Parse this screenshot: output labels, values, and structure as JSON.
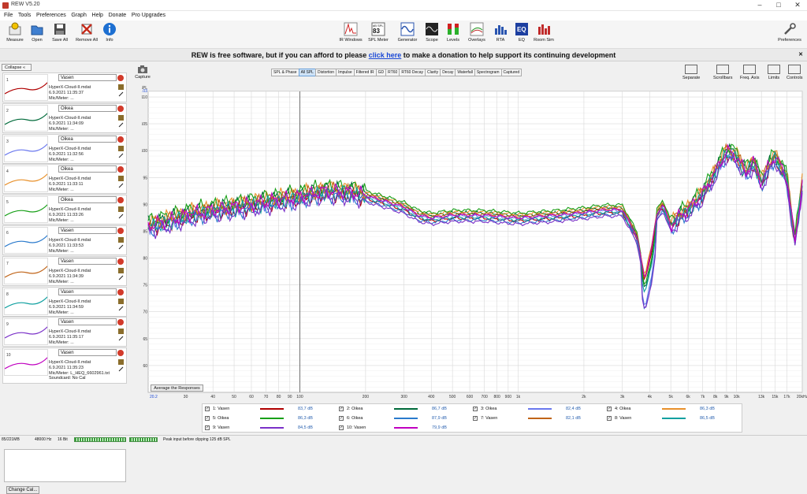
{
  "window": {
    "title": "REW V5.20",
    "minimize": "–",
    "maximize": "□",
    "close": "✕"
  },
  "menu": [
    "File",
    "Tools",
    "Preferences",
    "Graph",
    "Help",
    "Donate",
    "Pro Upgrades"
  ],
  "toolbar_left": [
    {
      "label": "Measure",
      "icon": "microphone-icon"
    },
    {
      "label": "Open",
      "icon": "folder-icon"
    },
    {
      "label": "Save All",
      "icon": "save-icon"
    },
    {
      "label": "Remove All",
      "icon": "remove-all-icon"
    },
    {
      "label": "Info",
      "icon": "info-icon"
    }
  ],
  "toolbar_center": [
    {
      "label": "IR Windows",
      "icon": "ir-windows-icon"
    },
    {
      "label": "SPL Meter",
      "icon": "spl-meter-icon",
      "top": "dB SPL",
      "value": "83"
    },
    {
      "label": "Generator",
      "icon": "generator-icon"
    },
    {
      "label": "Scope",
      "icon": "scope-icon"
    },
    {
      "label": "Levels",
      "icon": "levels-icon"
    },
    {
      "label": "Overlays",
      "icon": "overlays-icon"
    },
    {
      "label": "RTA",
      "icon": "rta-icon"
    },
    {
      "label": "EQ",
      "icon": "eq-icon"
    },
    {
      "label": "Room Sim",
      "icon": "room-sim-icon"
    }
  ],
  "toolbar_right": {
    "label": "Preferences",
    "icon": "wrench-icon"
  },
  "banner": {
    "pre": "REW is free software, but if you can afford to please ",
    "link": "click here",
    "post": " to make a donation to help support its continuing development"
  },
  "left_panel": {
    "collapse_label": "Collapse",
    "items": [
      {
        "num": "1",
        "name": "Vasen",
        "file": "HyperX-Cloud-II.mdat",
        "date": "6.9.2021 11:35:37",
        "mic": "Mic/Meter: ...",
        "color": "#b00000"
      },
      {
        "num": "2",
        "name": "Oikea",
        "file": "HyperX-Cloud-II.mdat",
        "date": "6.9.2021 11:34:09",
        "mic": "Mic/Meter: ...",
        "color": "#006a3a"
      },
      {
        "num": "3",
        "name": "Oikea",
        "file": "HyperX-Cloud-II.mdat",
        "date": "6.9.2021 11:32:56",
        "mic": "Mic/Meter: ...",
        "color": "#6a78ee"
      },
      {
        "num": "4",
        "name": "Oikea",
        "file": "HyperX-Cloud-II.mdat",
        "date": "6.9.2021 11:33:11",
        "mic": "Mic/Meter: ...",
        "color": "#e8902a"
      },
      {
        "num": "5",
        "name": "Oikea",
        "file": "HyperX-Cloud-II.mdat",
        "date": "6.9.2021 11:33:26",
        "mic": "Mic/Meter: ...",
        "color": "#18a018"
      },
      {
        "num": "6",
        "name": "Vasen",
        "file": "HyperX-Cloud-II.mdat",
        "date": "6.9.2021 11:33:53",
        "mic": "Mic/Meter: ...",
        "color": "#2a7acc"
      },
      {
        "num": "7",
        "name": "Vasen",
        "file": "HyperX-Cloud-II.mdat",
        "date": "6.9.2021 11:34:39",
        "mic": "Mic/Meter: ...",
        "color": "#c06418"
      },
      {
        "num": "8",
        "name": "Vasen",
        "file": "HyperX-Cloud-II.mdat",
        "date": "6.9.2021 11:34:59",
        "mic": "Mic/Meter: ...",
        "color": "#10a0a0"
      },
      {
        "num": "9",
        "name": "Vasen",
        "file": "HyperX-Cloud-II.mdat",
        "date": "6.9.2021 11:35:17",
        "mic": "Mic/Meter: ...",
        "color": "#7a30c8"
      },
      {
        "num": "10",
        "name": "Vasen",
        "file": "HyperX-Cloud-II.mdat",
        "date": "6.9.2021 11:35:23",
        "mic": "Mic/Meter: L_HEQ_6602961.txt",
        "soundcard": "Soundcard: No Cal",
        "color": "#c000c0"
      }
    ],
    "change_cal": "Change Cal..."
  },
  "capture_label": "Capture",
  "graph_tabs": [
    "SPL & Phase",
    "All SPL",
    "Distortion",
    "Impulse",
    "Filtered IR",
    "GD",
    "RT60",
    "RT60 Decay",
    "Clarity",
    "Decay",
    "Waterfall",
    "Spectrogram",
    "Captured"
  ],
  "graph_tab_selected": 1,
  "right_tools": [
    {
      "label": "Separate",
      "icon": "separate-icon"
    },
    {
      "label": "Scrollbars",
      "icon": "scrollbars-icon"
    },
    {
      "label": "Freq. Axis",
      "icon": "freq-axis-icon"
    },
    {
      "label": "Limits",
      "icon": "limits-icon"
    },
    {
      "label": "Controls",
      "icon": "controls-icon"
    }
  ],
  "average_button": "Average the Responses",
  "chart_data": {
    "type": "line",
    "ylabel": "SPL",
    "ylim": [
      55,
      111.03
    ],
    "ytop_label": "111.03",
    "yticks": [
      60,
      65,
      70,
      75,
      80,
      85,
      90,
      95,
      100,
      105,
      110
    ],
    "xscale": "log",
    "xlim": [
      20.2,
      20000
    ],
    "xstart_label": "20.2",
    "xticks": [
      {
        "v": 30,
        "l": "30"
      },
      {
        "v": 40,
        "l": "40"
      },
      {
        "v": 50,
        "l": "50"
      },
      {
        "v": 60,
        "l": "60"
      },
      {
        "v": 70,
        "l": "70"
      },
      {
        "v": 80,
        "l": "80"
      },
      {
        "v": 90,
        "l": "90"
      },
      {
        "v": 100,
        "l": "100"
      },
      {
        "v": 200,
        "l": "200"
      },
      {
        "v": 300,
        "l": "300"
      },
      {
        "v": 400,
        "l": "400"
      },
      {
        "v": 500,
        "l": "500"
      },
      {
        "v": 600,
        "l": "600"
      },
      {
        "v": 700,
        "l": "700"
      },
      {
        "v": 800,
        "l": "800"
      },
      {
        "v": 900,
        "l": "900"
      },
      {
        "v": 1000,
        "l": "1k"
      },
      {
        "v": 2000,
        "l": "2k"
      },
      {
        "v": 3000,
        "l": "3k"
      },
      {
        "v": 4000,
        "l": "4k"
      },
      {
        "v": 5000,
        "l": "5k"
      },
      {
        "v": 6000,
        "l": "6k"
      },
      {
        "v": 7000,
        "l": "7k"
      },
      {
        "v": 8000,
        "l": "8k"
      },
      {
        "v": 9000,
        "l": "9k"
      },
      {
        "v": 10000,
        "l": "10k"
      },
      {
        "v": 13000,
        "l": "13k"
      },
      {
        "v": 15000,
        "l": "15k"
      },
      {
        "v": 17000,
        "l": "17k"
      },
      {
        "v": 20000,
        "l": "20kHz"
      }
    ],
    "cursor_x": 100,
    "base_curve": {
      "f": [
        20,
        25,
        30,
        40,
        50,
        70,
        100,
        130,
        180,
        250,
        300,
        350,
        400,
        500,
        700,
        1000,
        1500,
        2000,
        2500,
        3000,
        3500,
        3800,
        4100,
        4300,
        4600,
        5000,
        5500,
        6000,
        7000,
        8000,
        9000,
        10000,
        11000,
        12000,
        13000,
        14000,
        15000,
        17000,
        18500,
        20000
      ],
      "v": [
        86,
        87,
        88,
        89,
        89.5,
        90.5,
        91.5,
        92.5,
        92.2,
        90.5,
        89.5,
        88,
        87.5,
        88,
        88,
        87.5,
        88,
        88.5,
        89,
        89,
        84,
        76,
        82,
        88,
        90,
        86,
        88,
        89,
        92,
        96,
        100,
        99,
        96,
        98,
        94,
        97,
        99,
        95,
        83,
        94
      ]
    },
    "series": [
      {
        "name": "1: Vasen",
        "color": "#b00000",
        "value": "83,7 dB",
        "offset": -0.6
      },
      {
        "name": "2: Oikea",
        "color": "#006a3a",
        "value": "86,7 dB",
        "offset": 0.4
      },
      {
        "name": "3: Oikea",
        "color": "#6a78ee",
        "value": "82,4 dB",
        "offset": -0.2
      },
      {
        "name": "4: Oikea",
        "color": "#e8902a",
        "value": "86,3 dB",
        "offset": 0.6
      },
      {
        "name": "5: Oikea",
        "color": "#18a018",
        "value": "86,3 dB",
        "offset": 0.9
      },
      {
        "name": "6: Oikea",
        "color": "#2a7acc",
        "value": "87,9 dB",
        "offset": -0.9
      },
      {
        "name": "7: Vasen",
        "color": "#c06418",
        "value": "82,1 dB",
        "offset": 0.2
      },
      {
        "name": "8: Vasen",
        "color": "#10a0a0",
        "value": "86,5 dB",
        "offset": -0.4
      },
      {
        "name": "9: Vasen",
        "color": "#7a30c8",
        "value": "84,5 dB",
        "offset": -1.2
      },
      {
        "name": "10: Vasen",
        "color": "#c000c0",
        "value": "79,9 dB",
        "offset": 0.0
      }
    ]
  },
  "status": {
    "mem": "85/221MB",
    "rate": "48000 Hz",
    "bits": "16 Bit",
    "peak": "Peak input before clipping 125 dB SPL"
  }
}
